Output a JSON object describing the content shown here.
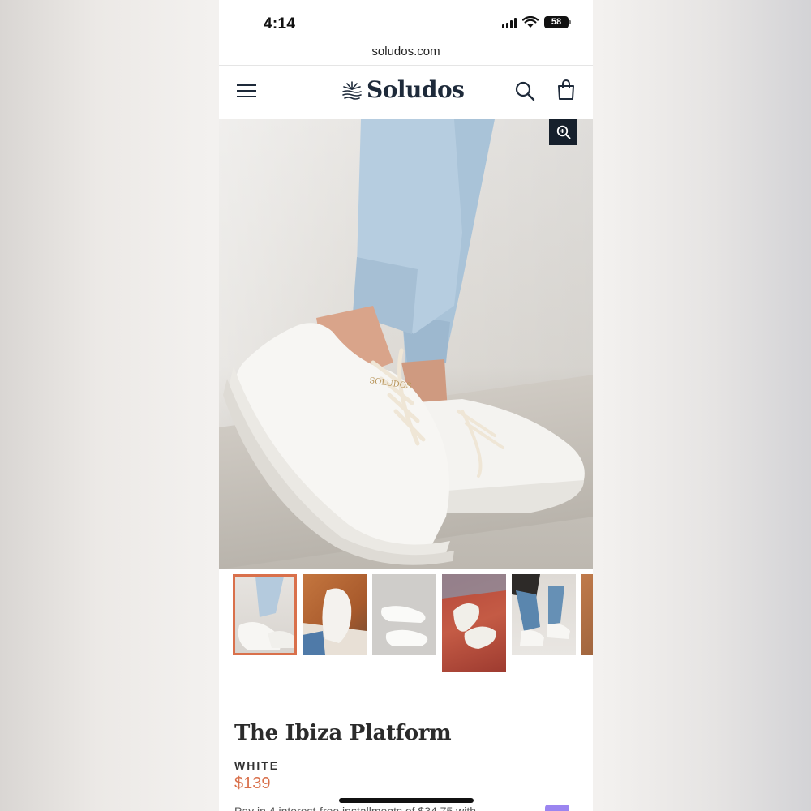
{
  "status_bar": {
    "time": "4:14",
    "battery": "58",
    "icons": [
      "signal-icon",
      "wifi-icon",
      "battery-icon"
    ]
  },
  "browser": {
    "url": "soludos.com"
  },
  "header": {
    "logo_text": "Soludos",
    "icons": [
      "menu-icon",
      "sun-logo-icon",
      "search-icon",
      "shopping-bag-icon"
    ]
  },
  "gallery": {
    "zoom_icon": "zoom-in-icon",
    "thumbnail_count": 6,
    "active_index": 0
  },
  "product": {
    "title": "The Ibiza Platform",
    "color": "WHITE",
    "price": "$139",
    "installment_text": "Pay in 4 interest-free installments of $34.75 with"
  },
  "colors": {
    "accent": "#d9704b",
    "brand_navy": "#1e2a3a",
    "zoom_bg": "#16202c"
  }
}
